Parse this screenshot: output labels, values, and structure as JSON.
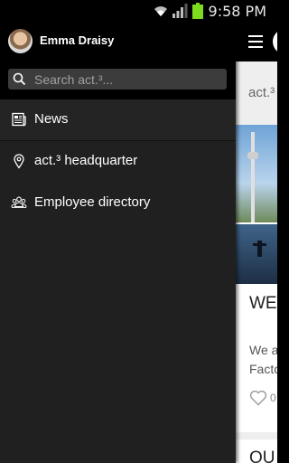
{
  "status_bar": {
    "time": "9:58 PM",
    "icons": [
      "wifi-icon",
      "signal-icon",
      "battery-icon"
    ],
    "battery_color": "#7ddc1f"
  },
  "drawer": {
    "user_name": "Emma Draisy",
    "search": {
      "placeholder": "Search act.³...",
      "value": ""
    },
    "menu": [
      {
        "label": "News",
        "icon": "newspaper-icon",
        "active": true
      },
      {
        "label": "act.³ headquarter",
        "icon": "location-pin-icon",
        "active": false
      },
      {
        "label": "Employee directory",
        "icon": "people-icon",
        "active": false
      }
    ]
  },
  "app": {
    "section_title": "act.³",
    "card": {
      "heading": "WE",
      "line1": "We a",
      "line2": "Facto",
      "likes": "0"
    },
    "card2": {
      "heading": "OU"
    }
  },
  "colors": {
    "drawer_bg": "#202020",
    "header_bg": "#000000",
    "search_bg": "#3c3c3c",
    "app_bg": "#eeeeee"
  }
}
